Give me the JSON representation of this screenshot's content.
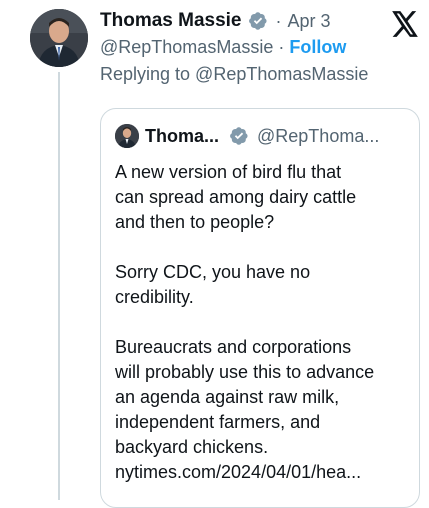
{
  "tweet": {
    "author_name": "Thomas Massie",
    "separator": "·",
    "date": "Apr 3",
    "handle": "@RepThomasMassie",
    "handle_separator": "·",
    "follow_label": "Follow",
    "replying_to": "Replying to @RepThomasMassie"
  },
  "quote": {
    "author_name": "Thoma...",
    "handle": "@RepThoma...",
    "lines": [
      "A new version of bird flu that",
      "can spread among dairy cattle",
      "and then to people?",
      "",
      "Sorry CDC, you have no",
      "credibility.",
      "",
      "Bureaucrats and corporations",
      "will probably use this to advance",
      "an agenda against raw milk,",
      "independent farmers, and",
      "backyard chickens.",
      "nytimes.com/2024/04/01/hea..."
    ]
  },
  "icons": {
    "verified": "verified-badge-icon",
    "brand": "x-logo-icon"
  },
  "colors": {
    "text": "#0f1419",
    "secondary": "#536471",
    "link": "#1d9bf0",
    "border": "#cfd9de",
    "verified_badge": "#829aab"
  }
}
